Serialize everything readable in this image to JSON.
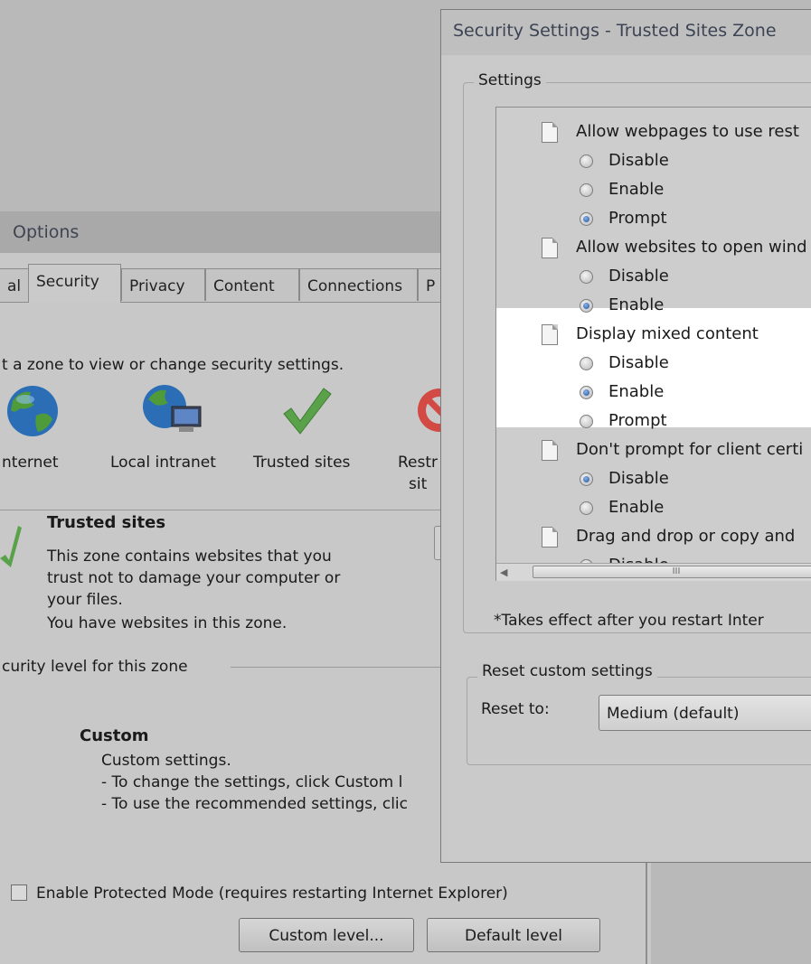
{
  "internet_options": {
    "title": "Options",
    "tabs": [
      "al",
      "Security",
      "Privacy",
      "Content",
      "Connections",
      "P"
    ],
    "zone_prompt": "t a zone to view or change security settings.",
    "zones": [
      "nternet",
      "Local intranet",
      "Trusted sites",
      "Restr",
      "sit"
    ],
    "zone_title": "Trusted sites",
    "zone_description": [
      "This zone contains websites that you",
      "trust not to damage your computer or",
      "your files.",
      "You have websites in this zone."
    ],
    "security_level_label": "curity level for this zone",
    "custom_title": "Custom",
    "custom_lines": [
      "Custom settings.",
      "- To change the settings, click Custom l",
      "- To use the recommended settings, clic"
    ],
    "protected_mode_label": "Enable Protected Mode (requires restarting Internet Explorer)",
    "protected_mode_checked": false,
    "custom_level_button": "Custom level...",
    "default_level_button": "Default level"
  },
  "security_settings": {
    "title": "Security Settings - Trusted Sites Zone",
    "settings_legend": "Settings",
    "items": [
      {
        "title": "Allow webpages to use rest",
        "options": [
          {
            "label": "Disable",
            "selected": false
          },
          {
            "label": "Enable",
            "selected": false
          },
          {
            "label": "Prompt",
            "selected": true
          }
        ]
      },
      {
        "title": "Allow websites to open wind",
        "options": [
          {
            "label": "Disable",
            "selected": false
          },
          {
            "label": "Enable",
            "selected": true
          }
        ]
      },
      {
        "title": "Display mixed content",
        "options": [
          {
            "label": "Disable",
            "selected": false
          },
          {
            "label": "Enable",
            "selected": true
          },
          {
            "label": "Prompt",
            "selected": false
          }
        ]
      },
      {
        "title": "Don't prompt for client certi",
        "options": [
          {
            "label": "Disable",
            "selected": true
          },
          {
            "label": "Enable",
            "selected": false
          }
        ]
      },
      {
        "title": "Drag and drop or copy and",
        "options": [
          {
            "label": "Disable",
            "selected": false
          }
        ]
      }
    ],
    "scroll_thumb_grip": "III",
    "takes_effect_note": "*Takes effect after you restart Inter",
    "reset_legend": "Reset custom settings",
    "reset_to_label": "Reset to:",
    "reset_to_value": "Medium (default)"
  }
}
